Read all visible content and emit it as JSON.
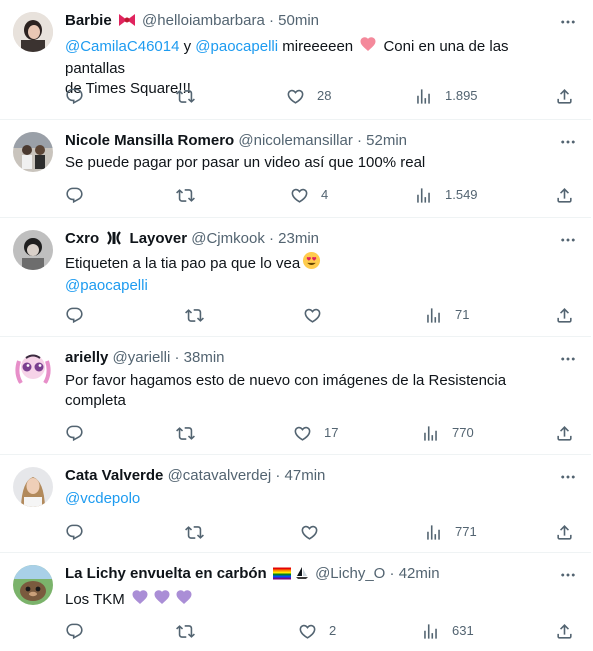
{
  "icons": {
    "reply": "reply-icon",
    "retweet": "retweet-icon",
    "like": "heart-icon",
    "views": "views-icon",
    "share": "share-icon",
    "more": "more-icon"
  },
  "tweets": [
    {
      "name": "Barbie",
      "handle": "@helloiambarbara",
      "time": "50min",
      "text_parts": [
        "@CamilaC46014",
        " y ",
        "@paocapelli",
        " mireeeeen ",
        " Coni en una de las pantallas",
        "de Times Square!!!"
      ],
      "likes": "28",
      "views": "1.895"
    },
    {
      "name": "Nicole Mansilla Romero",
      "handle": "@nicolemansillar",
      "time": "52min",
      "text": "Se puede pagar por pasar un video así que 100% real",
      "likes": "4",
      "views": "1.549"
    },
    {
      "name_a": "Cxro",
      "name_b": "Layover",
      "handle": "@Cjmkook",
      "time": "23min",
      "text": "Etiqueten a la tia pao pa que lo vea",
      "mention": "@paocapelli",
      "likes": "",
      "views": "71"
    },
    {
      "name": "arielly",
      "handle": "@yarielli",
      "time": "38min",
      "text_line1": "Por favor hagamos esto de nuevo con imágenes de la Resistencia",
      "text_line2": "completa",
      "likes": "17",
      "views": "770"
    },
    {
      "name": "Cata Valverde",
      "handle": "@catavalverdej",
      "time": "47min",
      "mention": "@vcdepolo",
      "likes": "",
      "views": "771"
    },
    {
      "name": "La Lichy envuelta en carbón",
      "handle": "@Lichy_O",
      "time": "42min",
      "text": "Los TKM",
      "likes": "2",
      "views": "631"
    }
  ],
  "separator": "·"
}
